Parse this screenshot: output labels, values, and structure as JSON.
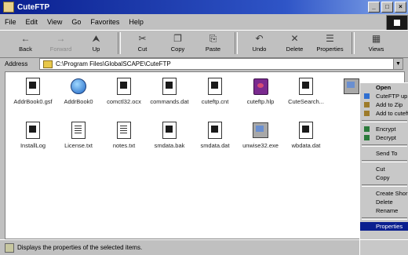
{
  "window": {
    "title": "CuteFTP"
  },
  "menu": [
    "File",
    "Edit",
    "View",
    "Go",
    "Favorites",
    "Help"
  ],
  "toolbar": [
    {
      "label": "Back",
      "icon": "back-arrow-icon",
      "glyph": "←"
    },
    {
      "label": "Forward",
      "icon": "forward-arrow-icon",
      "glyph": "→",
      "disabled": true
    },
    {
      "label": "Up",
      "icon": "up-folder-icon",
      "glyph": "⮝"
    },
    {
      "label": "Cut",
      "icon": "scissors-icon",
      "glyph": "✂"
    },
    {
      "label": "Copy",
      "icon": "copy-icon",
      "glyph": "❐"
    },
    {
      "label": "Paste",
      "icon": "paste-icon",
      "glyph": "⎘"
    },
    {
      "label": "Undo",
      "icon": "undo-icon",
      "glyph": "↶"
    },
    {
      "label": "Delete",
      "icon": "delete-icon",
      "glyph": "✕"
    },
    {
      "label": "Properties",
      "icon": "properties-icon",
      "glyph": "☰"
    },
    {
      "label": "Views",
      "icon": "views-icon",
      "glyph": "▦"
    }
  ],
  "address": {
    "label": "Address",
    "path": "C:\\Program Files\\GlobalSCAPE\\CuteFTP"
  },
  "files_row1": [
    {
      "name": "AddrBook0.gsf",
      "type": "doc"
    },
    {
      "name": "AddrBook0",
      "type": "globe"
    },
    {
      "name": "comctl32.ocx",
      "type": "doc"
    },
    {
      "name": "commands.dat",
      "type": "doc"
    },
    {
      "name": "cuteftp.cnt",
      "type": "doc"
    },
    {
      "name": "cuteftp.hlp",
      "type": "book"
    },
    {
      "name": "CuteSearch...",
      "type": "doc"
    },
    {
      "name": "",
      "type": "comp",
      "selected": true
    }
  ],
  "files_row2": [
    {
      "name": "InstallLog",
      "type": "doc"
    },
    {
      "name": "License.txt",
      "type": "txt"
    },
    {
      "name": "notes.txt",
      "type": "txt"
    },
    {
      "name": "smdata.bak",
      "type": "doc"
    },
    {
      "name": "smdata.dat",
      "type": "doc"
    },
    {
      "name": "unwise32.exe",
      "type": "comp"
    },
    {
      "name": "wbdata.dat",
      "type": "doc"
    }
  ],
  "context_menu": [
    {
      "label": "Open",
      "bold": true
    },
    {
      "label": "CuteFTP up",
      "icon": "#2f6fd1"
    },
    {
      "label": "Add to Zip",
      "icon": "#9d7b2a"
    },
    {
      "label": "Add to cuteftp",
      "icon": "#9d7b2a"
    },
    {
      "sep": true
    },
    {
      "label": "Encrypt",
      "icon": "#2a7a3a"
    },
    {
      "label": "Decrypt",
      "icon": "#2a7a3a"
    },
    {
      "sep": true
    },
    {
      "label": "Send To"
    },
    {
      "sep": true
    },
    {
      "label": "Cut"
    },
    {
      "label": "Copy"
    },
    {
      "sep": true
    },
    {
      "label": "Create Shor"
    },
    {
      "label": "Delete"
    },
    {
      "label": "Rename"
    },
    {
      "sep": true
    },
    {
      "label": "Properties",
      "highlight": true
    }
  ],
  "status": {
    "text": "Displays the properties of the selected items."
  }
}
